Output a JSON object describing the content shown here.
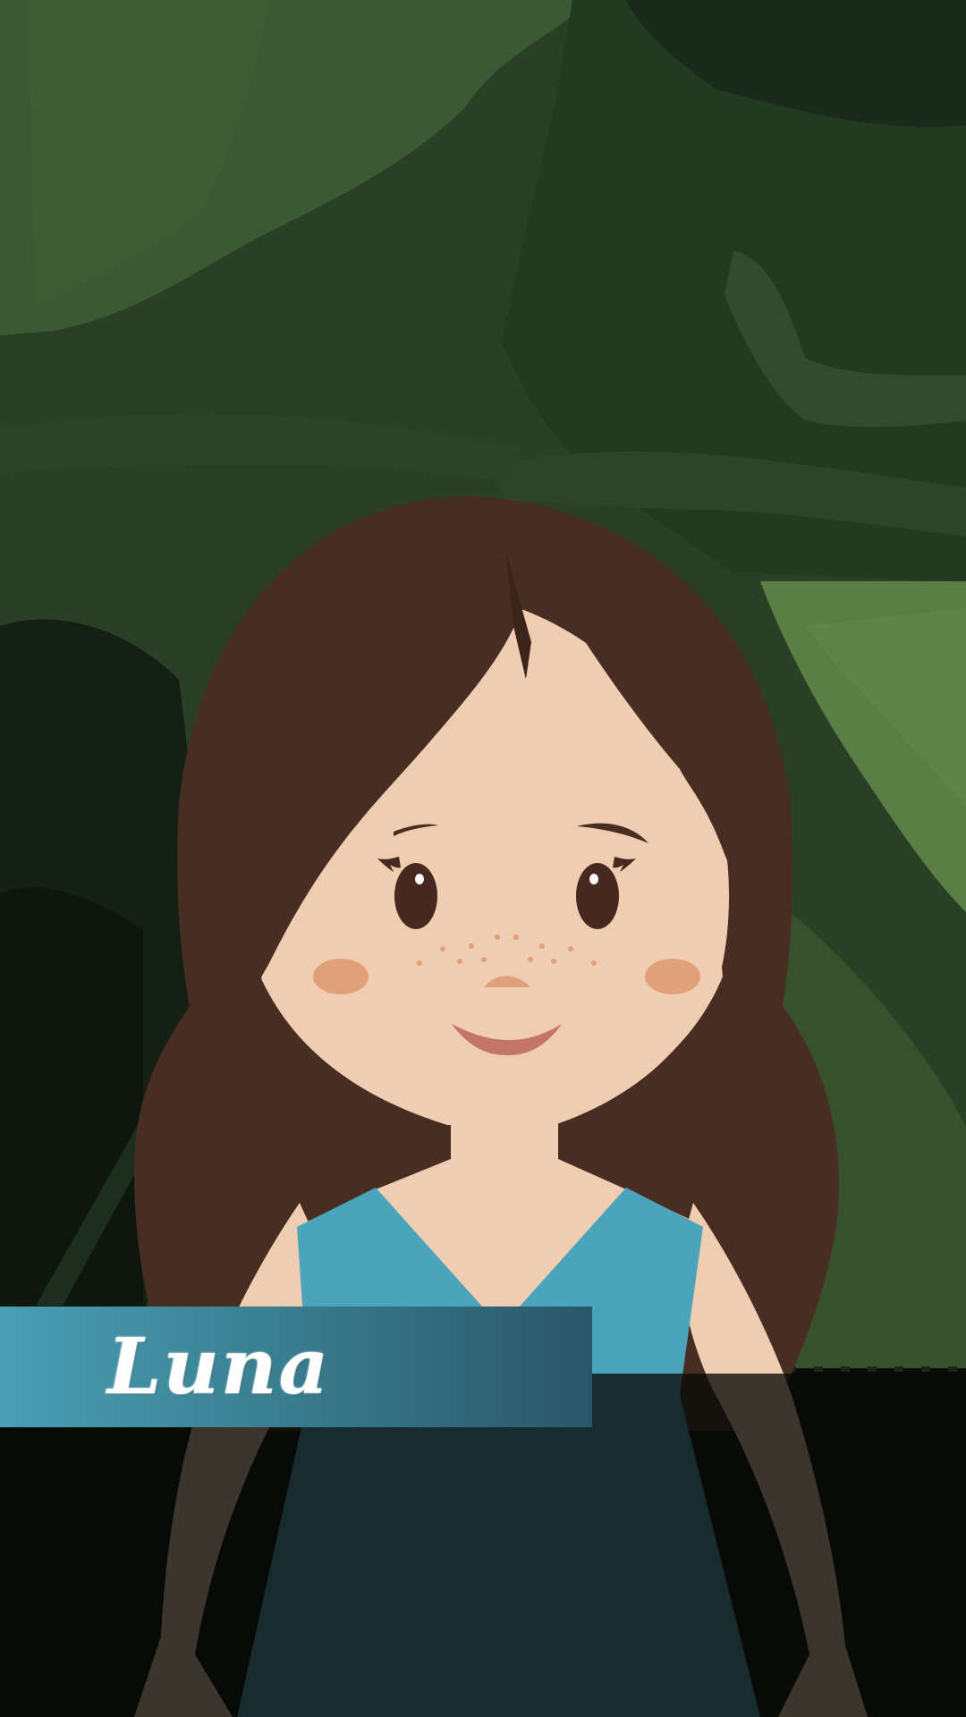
{
  "scene": {
    "type": "visual-novel-dialogue",
    "location": "forest"
  },
  "character": {
    "name": "Luna",
    "hair_color": "#472d22",
    "skin_color": "#f0cdb0",
    "dress_color": "#4aa4bb",
    "eye_color": "#47291f",
    "blush_color": "#e0a07a",
    "mouth_color": "#c47468"
  },
  "nameplate": {
    "label": "Luna",
    "gradient_start": "#4a9fb3",
    "gradient_end": "#2a5668"
  },
  "dialogue_box": {
    "text": "",
    "background": "#080a08"
  },
  "colors": {
    "forest_light": "#5a7f44",
    "forest_mid": "#35502f",
    "forest_dark": "#1a2a1a"
  }
}
